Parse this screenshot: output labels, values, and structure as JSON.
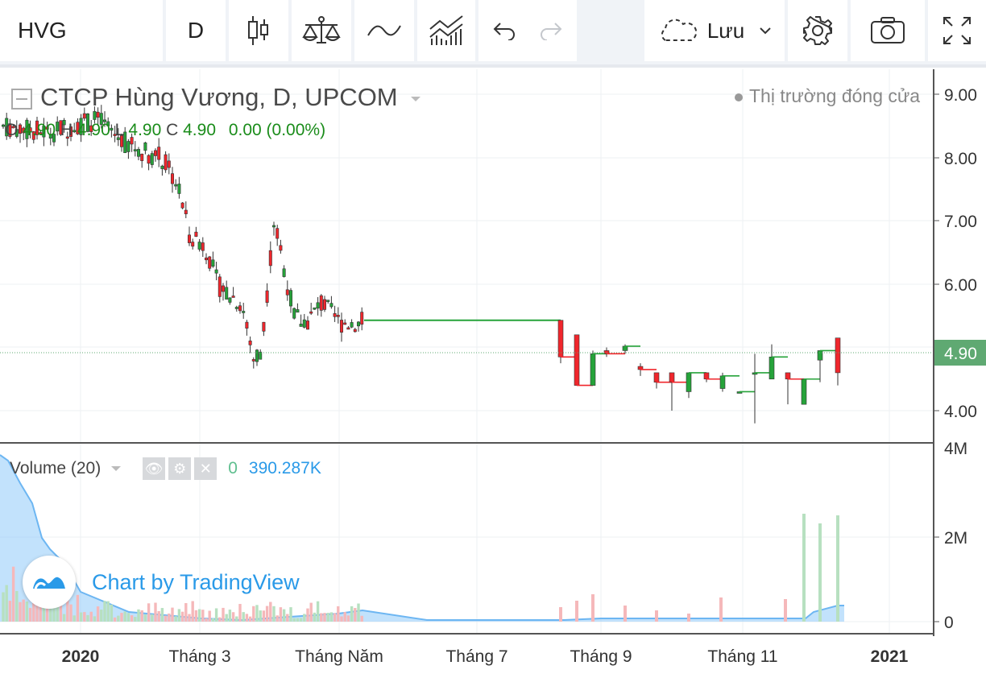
{
  "toolbar": {
    "symbol": "HVG",
    "interval": "D",
    "save_label": "Lưu"
  },
  "legend": {
    "title": "CTCP Hùng Vương, D, UPCOM",
    "o_key": "O",
    "o_val": "4.90",
    "h_key": "H",
    "h_val": "4.90",
    "l_key": "L",
    "l_val": "4.90",
    "c_key": "C",
    "c_val": "4.90",
    "change": "0.00 (0.00%)",
    "market_status": "Thị trường đóng cửa"
  },
  "volume_legend": {
    "label": "Volume (20)",
    "value_0": "0",
    "value_ma": "390.287K"
  },
  "price_axis": {
    "labels": [
      "9.00",
      "8.00",
      "7.00",
      "6.00",
      "4.00"
    ],
    "last_price": "4.90"
  },
  "volume_axis": {
    "labels": [
      "4M",
      "2M",
      "0"
    ]
  },
  "time_axis": {
    "labels": [
      "2020",
      "Tháng 3",
      "Tháng Năm",
      "Tháng 7",
      "Tháng 9",
      "Tháng 11",
      "2021"
    ]
  },
  "watermark": "Chart by TradingView",
  "colors": {
    "up": "#26a33a",
    "down": "#f0262c",
    "volume_area": "#90caf9",
    "last_price_tag": "#5fa972",
    "watermark": "#2a9ae8"
  }
}
